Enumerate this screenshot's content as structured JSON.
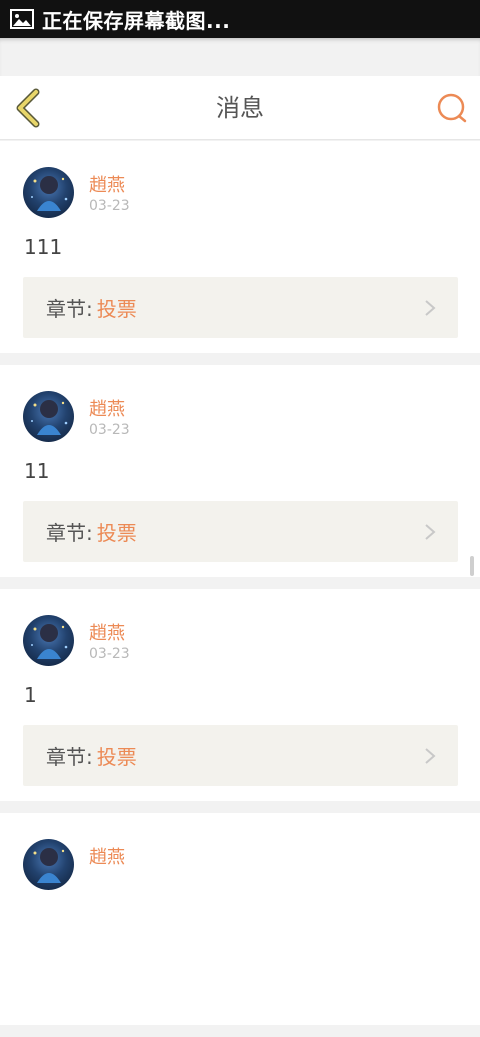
{
  "status_bar": {
    "text": "正在保存屏幕截图..."
  },
  "header": {
    "title": "消息"
  },
  "messages": [
    {
      "user": "趙燕",
      "time": "03-23",
      "content": "111",
      "chapter_label": "章节:",
      "chapter_value": "投票"
    },
    {
      "user": "趙燕",
      "time": "03-23",
      "content": "11",
      "chapter_label": "章节:",
      "chapter_value": "投票"
    },
    {
      "user": "趙燕",
      "time": "03-23",
      "content": "1",
      "chapter_label": "章节:",
      "chapter_value": "投票"
    },
    {
      "user": "趙燕"
    }
  ],
  "colors": {
    "accent": "#ec8a55",
    "back_icon": "#e8d66a",
    "background": "#f2f2f2"
  }
}
